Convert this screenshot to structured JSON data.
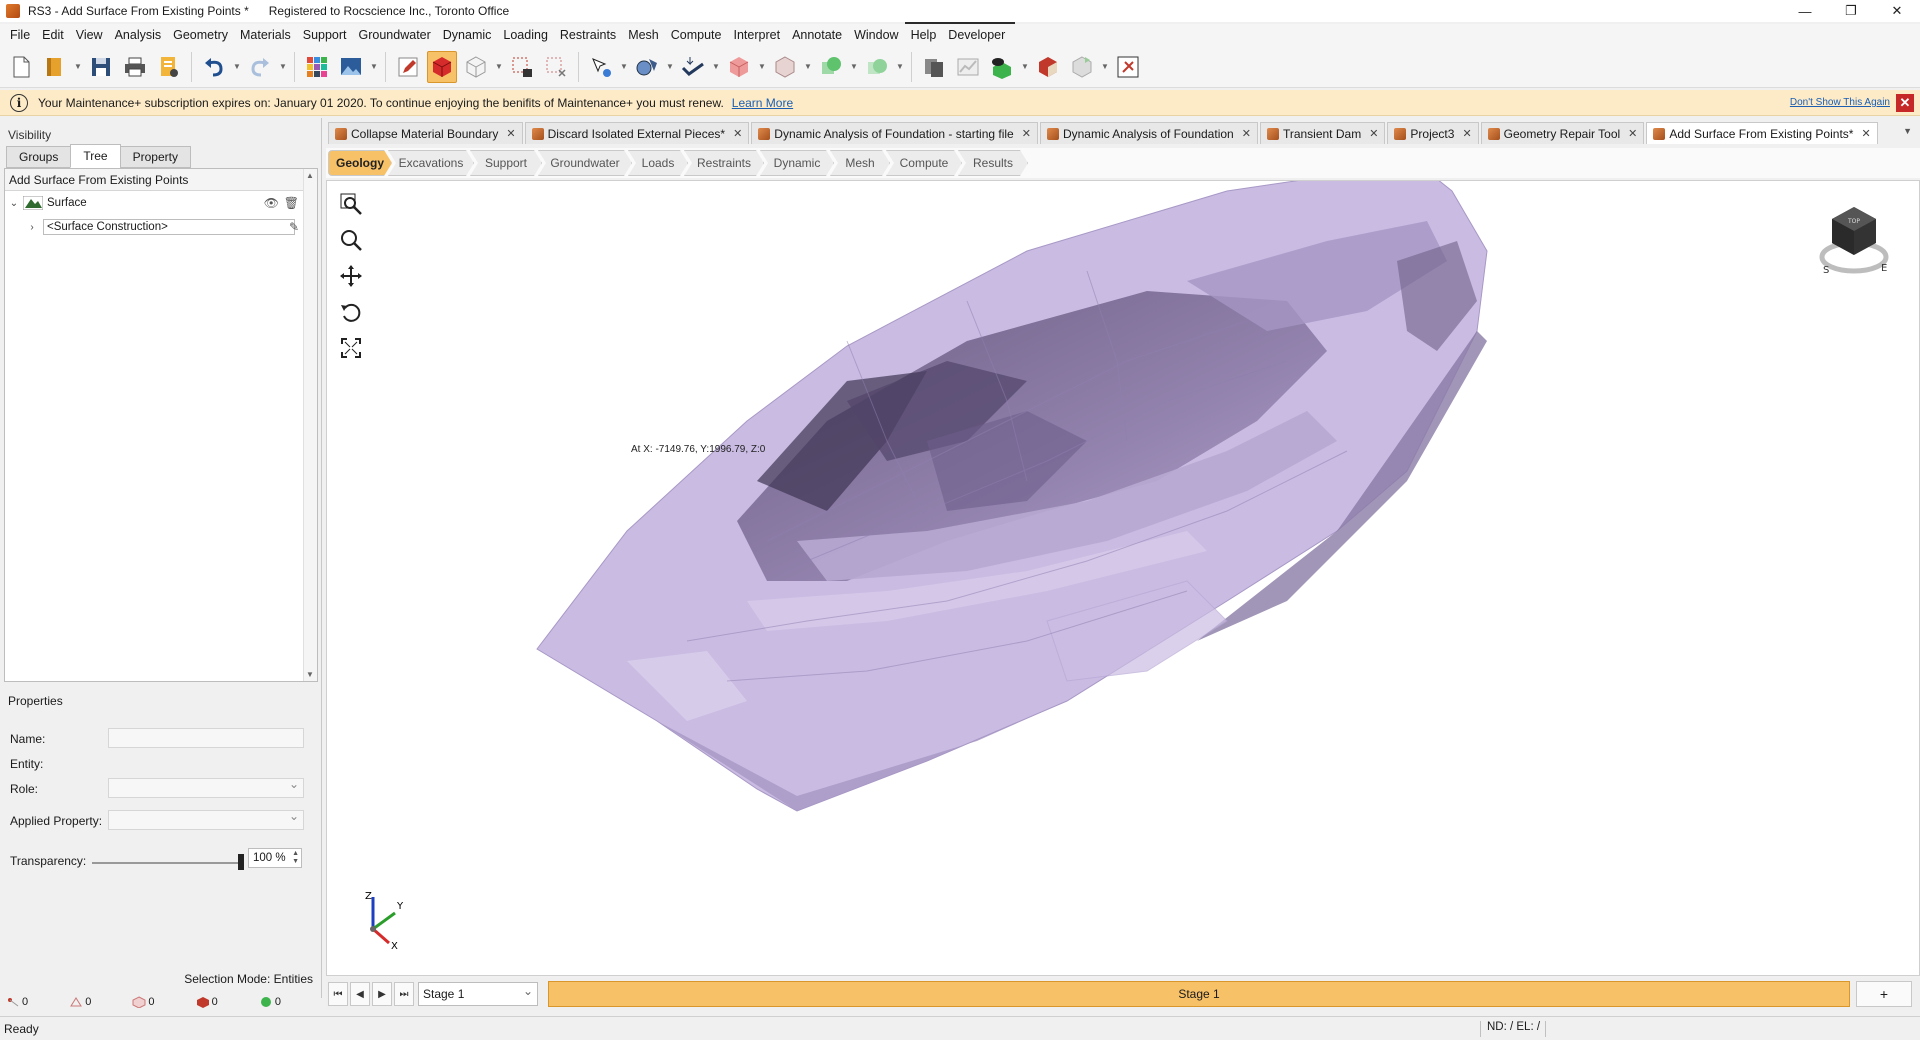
{
  "window": {
    "title": "RS3 - Add Surface From Existing Points *",
    "registration": "Registered to Rocscience Inc., Toronto Office",
    "controls": {
      "minimize": "—",
      "maximize": "❐",
      "close": "✕"
    }
  },
  "menu": [
    "File",
    "Edit",
    "View",
    "Analysis",
    "Geometry",
    "Materials",
    "Support",
    "Groundwater",
    "Dynamic",
    "Loading",
    "Restraints",
    "Mesh",
    "Compute",
    "Interpret",
    "Annotate",
    "Window",
    "Help",
    "Developer"
  ],
  "notice": {
    "text": "Your Maintenance+ subscription expires on: January 01 2020. To continue enjoying the benifits of Maintenance+ you must renew.",
    "link": "Learn More",
    "dont_show": "Don't Show This Again",
    "close": "✕",
    "icon": "info-icon"
  },
  "left_panel": {
    "visibility_label": "Visibility",
    "tabs": [
      "Groups",
      "Tree",
      "Property"
    ],
    "active_tab": "Tree",
    "tree_header": "Add Surface From Existing Points",
    "tree": {
      "surface_label": "Surface",
      "construction_label": "<Surface Construction>"
    },
    "properties": {
      "title": "Properties",
      "name_label": "Name:",
      "entity_label": "Entity:",
      "role_label": "Role:",
      "applied_property_label": "Applied Property:",
      "transparency_label": "Transparency:",
      "transparency_value": "100 %",
      "transparency_level": 1.0
    },
    "selection_mode": "Selection Mode: Entities",
    "counters": [
      "0",
      "0",
      "0",
      "0",
      "0"
    ]
  },
  "doc_tabs": [
    {
      "label": "Collapse Material Boundary",
      "active": false
    },
    {
      "label": "Discard Isolated External Pieces*",
      "active": false
    },
    {
      "label": "Dynamic Analysis of Foundation - starting file",
      "active": false
    },
    {
      "label": "Dynamic Analysis of Foundation",
      "active": false
    },
    {
      "label": "Transient Dam",
      "active": false
    },
    {
      "label": "Project3",
      "active": false
    },
    {
      "label": "Geometry Repair Tool",
      "active": false
    },
    {
      "label": "Add Surface From Existing Points*",
      "active": true
    }
  ],
  "workflow": [
    "Geology",
    "Excavations",
    "Support",
    "Groundwater",
    "Loads",
    "Restraints",
    "Dynamic",
    "Mesh",
    "Compute",
    "Results"
  ],
  "viewport": {
    "coord_readout": "At X: -7149.76, Y:1996.79, Z:0",
    "surface_color": "#cbbde3",
    "triad": {
      "z": "Z",
      "y": "Y",
      "x": "X"
    },
    "cube_labels": {
      "top": "TOP",
      "south": "S",
      "east": "E"
    }
  },
  "stagebar": {
    "select_value": "Stage 1",
    "bar_label": "Stage 1",
    "add": "+"
  },
  "status": {
    "text": "Ready",
    "nd": "ND: /  EL: /"
  },
  "colors": {
    "accent": "#f7c168",
    "notice_bg": "#fdebc8",
    "link": "#1a5fb4"
  }
}
